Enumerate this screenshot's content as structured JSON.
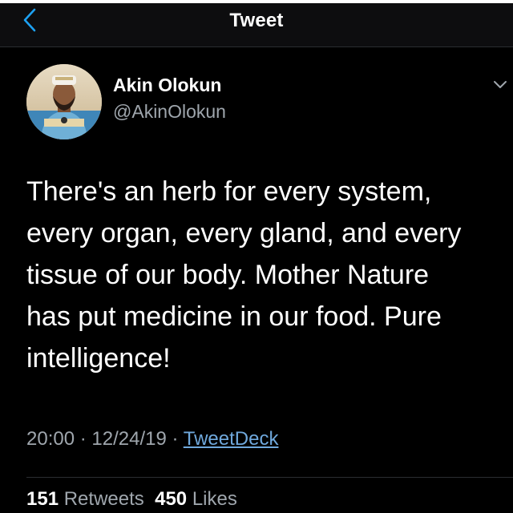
{
  "header": {
    "title": "Tweet",
    "back_icon": "chevron-left-icon"
  },
  "author": {
    "name": "Akin Olokun",
    "handle": "@AkinOlokun"
  },
  "tweet": {
    "text": "There's an herb for every system,\nevery organ, every gland, and every\ntissue of our body. Mother Nature\nhas put medicine in our food. Pure\nintelligence!",
    "time": "20:00",
    "separator": "·",
    "date": "12/24/19",
    "source": "TweetDeck"
  },
  "stats": {
    "retweets_count": "151",
    "retweets_label": "Retweets",
    "likes_count": "450",
    "likes_label": "Likes"
  },
  "colors": {
    "background": "#000000",
    "header_bg": "#0d0d0f",
    "accent": "#1da1f2",
    "secondary_text": "#9fa6ad"
  }
}
